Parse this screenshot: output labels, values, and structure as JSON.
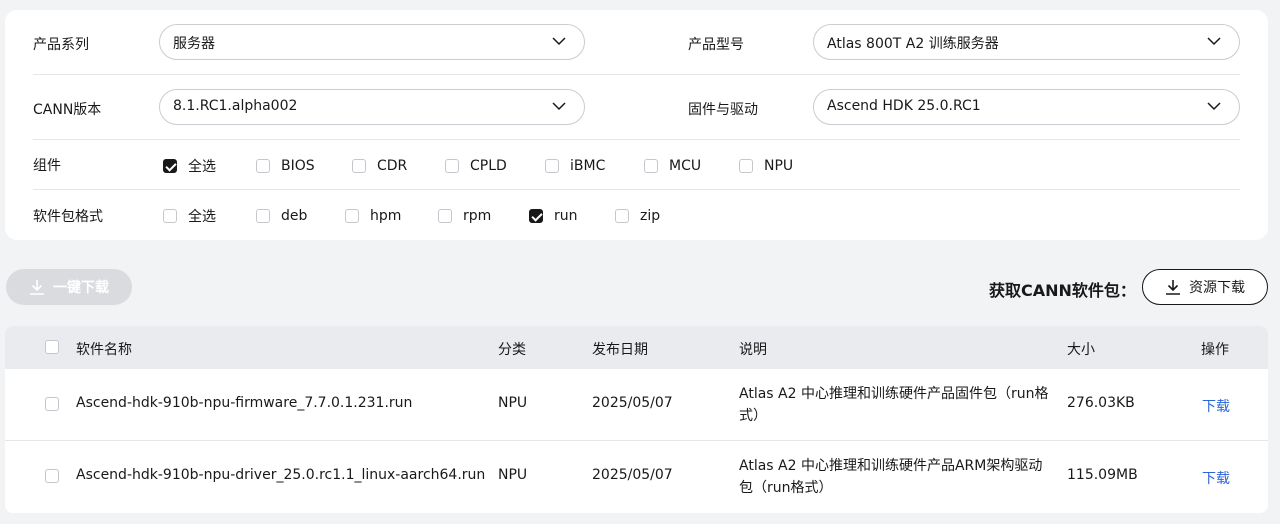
{
  "filters": {
    "series_label": "产品系列",
    "series_value": "服务器",
    "model_label": "产品型号",
    "model_value": "Atlas 800T A2 训练服务器",
    "cann_label": "CANN版本",
    "cann_value": "8.1.RC1.alpha002",
    "firmware_label": "固件与驱动",
    "firmware_value": "Ascend HDK 25.0.RC1",
    "components_label": "组件",
    "components": [
      {
        "label": "全选",
        "checked": true
      },
      {
        "label": "BIOS",
        "checked": false
      },
      {
        "label": "CDR",
        "checked": false
      },
      {
        "label": "CPLD",
        "checked": false
      },
      {
        "label": "iBMC",
        "checked": false
      },
      {
        "label": "MCU",
        "checked": false
      },
      {
        "label": "NPU",
        "checked": false
      }
    ],
    "formats_label": "软件包格式",
    "formats": [
      {
        "label": "全选",
        "checked": false
      },
      {
        "label": "deb",
        "checked": false
      },
      {
        "label": "hpm",
        "checked": false
      },
      {
        "label": "rpm",
        "checked": false
      },
      {
        "label": "run",
        "checked": true
      },
      {
        "label": "zip",
        "checked": false
      }
    ]
  },
  "actions": {
    "one_click_download": "一键下载",
    "get_cann_label": "获取CANN软件包：",
    "resource_download": "资源下载"
  },
  "table": {
    "headers": {
      "name": "软件名称",
      "category": "分类",
      "date": "发布日期",
      "desc": "说明",
      "size": "大小",
      "op": "操作"
    },
    "rows": [
      {
        "name": "Ascend-hdk-910b-npu-firmware_7.7.0.1.231.run",
        "category": "NPU",
        "date": "2025/05/07",
        "desc": "Atlas A2 中心推理和训练硬件产品固件包（run格式）",
        "size": "276.03KB",
        "op": "下载"
      },
      {
        "name": "Ascend-hdk-910b-npu-driver_25.0.rc1.1_linux-aarch64.run",
        "category": "NPU",
        "date": "2025/05/07",
        "desc": "Atlas A2 中心推理和训练硬件产品ARM架构驱动包（run格式）",
        "size": "115.09MB",
        "op": "下载"
      }
    ]
  },
  "colors": {
    "accent_link": "#2b66d9",
    "checked_box": "#191919",
    "disabled_button": "#d9dbde"
  },
  "icons": [
    "chevron-down-icon",
    "download-icon",
    "checkbox-icon"
  ]
}
